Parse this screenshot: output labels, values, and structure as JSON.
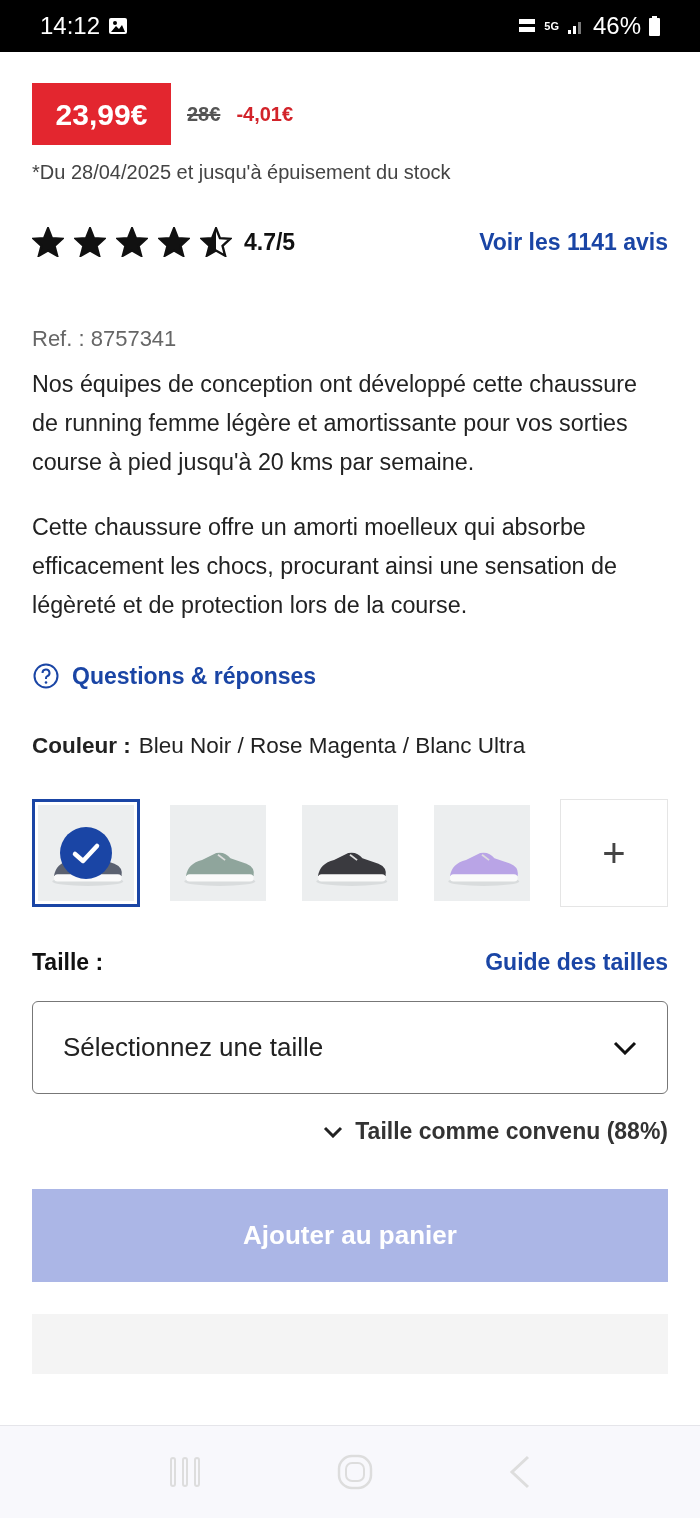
{
  "status_bar": {
    "time": "14:12",
    "network": "5G",
    "battery": "46%"
  },
  "price": {
    "current": "23,99€",
    "old": "28€",
    "discount": "-4,01€",
    "note": "*Du 28/04/2025 et jusqu'à épuisement du stock"
  },
  "rating": {
    "stars": 4.5,
    "score": "4.7/5",
    "reviews_link": "Voir les 1141 avis"
  },
  "reference": "Ref. : 8757341",
  "description": [
    "Nos équipes de conception ont développé cette chaussure de running femme légère et amortissante pour vos sorties course à pied jusqu'à 20 kms par semaine.",
    "Cette chaussure offre un amorti moelleux qui absorbe efficacement les chocs, procurant ainsi une sensation de légèreté et de protection lors de la course."
  ],
  "qa_link": "Questions & réponses",
  "color": {
    "label": "Couleur :",
    "value": "Bleu Noir / Rose Magenta / Blanc Ultra"
  },
  "swatches": [
    {
      "kind": "picture",
      "selected": true
    },
    {
      "kind": "picture",
      "selected": false
    },
    {
      "kind": "picture",
      "selected": false
    },
    {
      "kind": "picture",
      "selected": false
    },
    {
      "kind": "more",
      "label": "+"
    }
  ],
  "size": {
    "label": "Taille :",
    "guide_link": "Guide des tailles",
    "placeholder": "Sélectionnez une taille",
    "fit": "Taille comme convenu (88%)"
  },
  "add_to_cart": {
    "label": "Ajouter au panier",
    "disabled": true
  }
}
